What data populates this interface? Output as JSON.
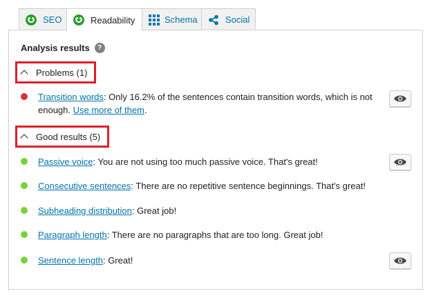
{
  "tabs": [
    {
      "label": "SEO",
      "icon": "smiley-icon",
      "active": false
    },
    {
      "label": "Readability",
      "icon": "smiley-icon",
      "active": true
    },
    {
      "label": "Schema",
      "icon": "grid-icon",
      "active": false
    },
    {
      "label": "Social",
      "icon": "share-icon",
      "active": false
    }
  ],
  "analysis": {
    "title": "Analysis results",
    "help_glyph": "?"
  },
  "problems": {
    "header": "Problems (1)",
    "items": [
      {
        "link": "Transition words",
        "text": ": Only 16.2% of the sentences contain transition words, which is not enough. ",
        "link2": "Use more of them",
        "tail": "."
      }
    ]
  },
  "good": {
    "header": "Good results (5)",
    "items": [
      {
        "link": "Passive voice",
        "text": ": You are not using too much passive voice. That's great!"
      },
      {
        "link": "Consecutive sentences",
        "text": ": There are no repetitive sentence beginnings. That's great!"
      },
      {
        "link": "Subheading distribution",
        "text": ": Great job!"
      },
      {
        "link": "Paragraph length",
        "text": ": There are no paragraphs that are too long. Great job!"
      },
      {
        "link": "Sentence length",
        "text": ": Great!"
      }
    ]
  },
  "colors": {
    "problem": "#dc3232",
    "good": "#7ad03a",
    "link": "#0073aa",
    "highlight": "#dd1f2a"
  }
}
